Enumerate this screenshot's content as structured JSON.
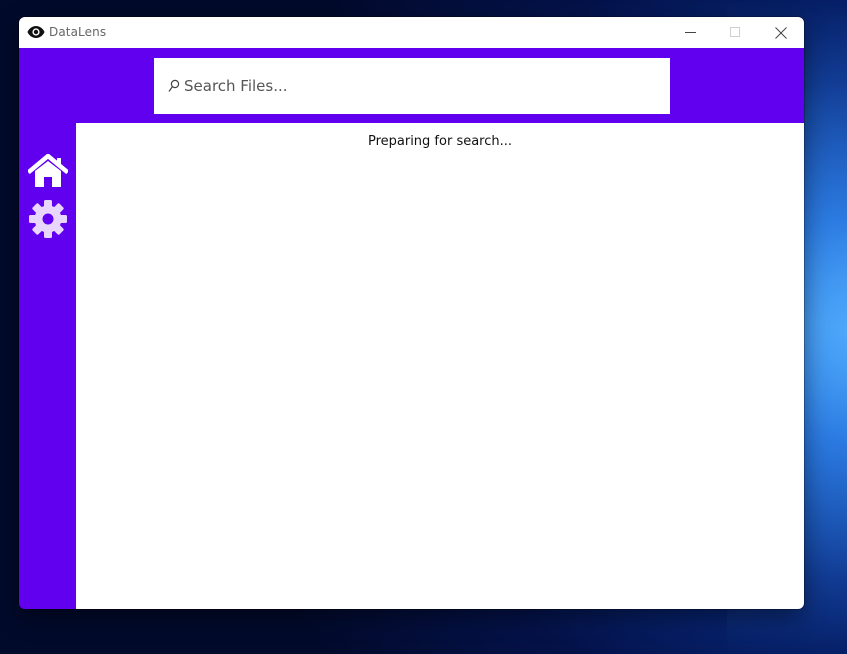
{
  "window": {
    "title": "DataLens",
    "title_icon": "eye-icon",
    "controls": {
      "minimize_icon": "minimize-icon",
      "maximize_icon": "maximize-icon",
      "close_icon": "close-icon"
    }
  },
  "search": {
    "placeholder": "Search Files...",
    "value": "",
    "icon": "search-icon"
  },
  "sidebar": {
    "items": [
      {
        "id": "home",
        "icon": "home-icon"
      },
      {
        "id": "settings",
        "icon": "gear-icon"
      }
    ]
  },
  "main": {
    "status": "Preparing for search..."
  },
  "colors": {
    "accent": "#6100ee",
    "content_bg": "#ffffff",
    "icon_home": "#ffffff",
    "icon_settings": "#e8d6ff"
  }
}
